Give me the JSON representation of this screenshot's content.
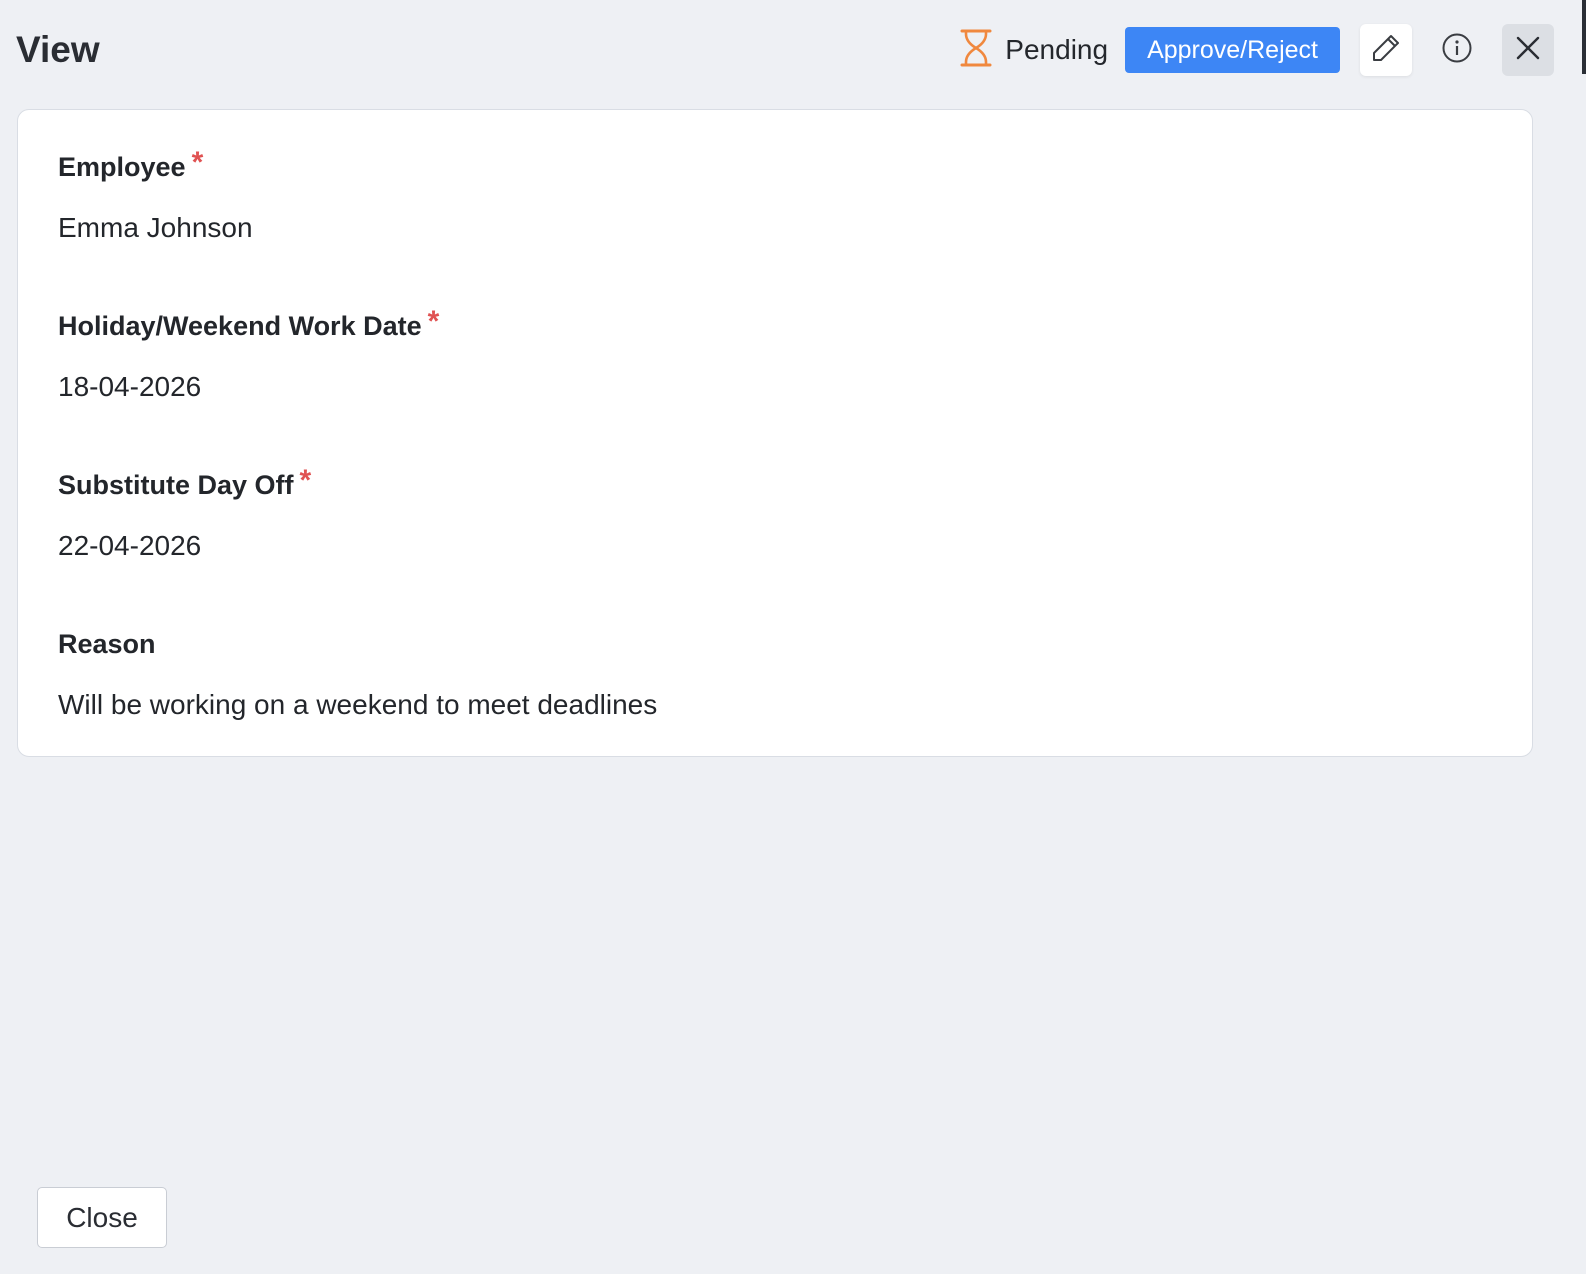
{
  "header": {
    "title": "View",
    "status_icon": "hourglass-icon",
    "status_label": "Pending",
    "approve_label": "Approve/Reject",
    "edit_icon": "pencil-icon",
    "info_icon": "info-icon",
    "close_icon": "close-icon"
  },
  "fields": [
    {
      "label": "Employee",
      "required": true,
      "value": "Emma Johnson"
    },
    {
      "label": "Holiday/Weekend Work Date",
      "required": true,
      "value": "18-04-2026"
    },
    {
      "label": "Substitute Day Off",
      "required": true,
      "value": "22-04-2026"
    },
    {
      "label": "Reason",
      "required": false,
      "value": "Will be working on a weekend to meet deadlines"
    }
  ],
  "required_marker": "*",
  "footer": {
    "close_label": "Close"
  },
  "colors": {
    "accent": "#3d86f5",
    "status_pending": "#f0883e",
    "required": "#e05252",
    "background": "#eef0f4"
  }
}
